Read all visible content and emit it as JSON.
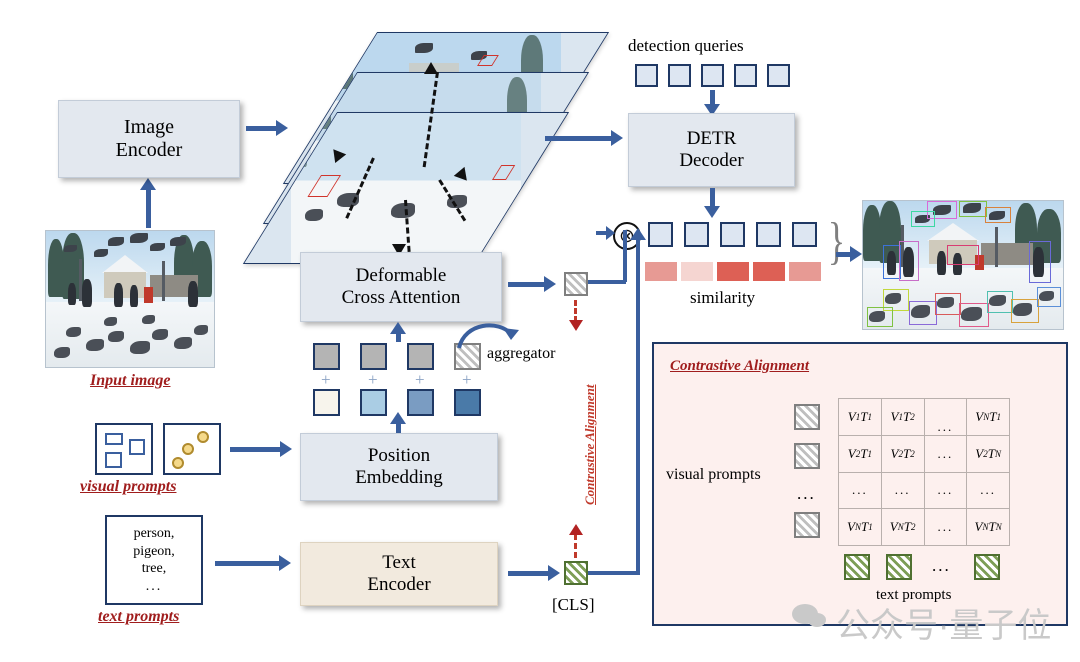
{
  "modules": {
    "image_encoder": "Image\nEncoder",
    "image_encoder_l1": "Image",
    "image_encoder_l2": "Encoder",
    "detr_l1": "DETR",
    "detr_l2": "Decoder",
    "deformable_l1": "Deformable",
    "deformable_l2": "Cross Attention",
    "position_l1": "Position",
    "position_l2": "Embedding",
    "text_l1": "Text",
    "text_l2": "Encoder"
  },
  "labels": {
    "input_image": "Input image",
    "visual_prompts": "visual prompts",
    "text_prompts": "text prompts",
    "detection_queries": "detection queries",
    "similarity": "similarity",
    "aggregator": "aggregator",
    "cls": "[CLS]",
    "contrastive_vertical": "Contrastive Alignment",
    "contrastive_title": "Contrastive Alignment",
    "panel_visual_prompts": "visual prompts",
    "panel_text_prompts": "text prompts",
    "ellipsis": "...",
    "otimes": "⊗",
    "plus": "+"
  },
  "text_prompt_box": {
    "lines": [
      "person,",
      "pigeon,",
      "tree,",
      "..."
    ]
  },
  "detection_queries": {
    "count": 5
  },
  "decoder_outputs": {
    "count": 5
  },
  "similarity_bars": {
    "colors": [
      "#e79a94",
      "#f5d5d1",
      "#dd6055",
      "#dd6055",
      "#e79a94"
    ],
    "values": [
      0.55,
      0.18,
      0.9,
      0.9,
      0.55
    ]
  },
  "aggregator_tokens": {
    "top_color": "#b4b4b4",
    "bottom_colors": [
      "#f7f4ec",
      "#aacde4",
      "#7a9cc2",
      "#4a7aa8"
    ]
  },
  "matrix": {
    "rows": [
      [
        {
          "t": "V",
          "sub": "1",
          "t2": "T",
          "sub2": "1"
        },
        {
          "t": "V",
          "sub": "1",
          "t2": "T",
          "sub2": "2"
        },
        {
          "dots": true
        },
        {
          "t": "V",
          "sub": "N",
          "t2": "T",
          "sub2": "1"
        }
      ],
      [
        {
          "t": "V",
          "sub": "2",
          "t2": "T",
          "sub2": "1"
        },
        {
          "t": "V",
          "sub": "2",
          "t2": "T",
          "sub2": "2"
        },
        {
          "dots": true
        },
        {
          "t": "V",
          "sub": "2",
          "t2": "T",
          "sub2": "N"
        }
      ],
      [
        {
          "dots": true
        },
        {
          "dots": true
        },
        {
          "dots": true
        },
        {
          "dots": true
        }
      ],
      [
        {
          "t": "V",
          "sub": "N",
          "t2": "T",
          "sub2": "1"
        },
        {
          "t": "V",
          "sub": "N",
          "t2": "T",
          "sub2": "2"
        },
        {
          "dots": true
        },
        {
          "t": "V",
          "sub": "N",
          "t2": "T",
          "sub2": "N"
        }
      ]
    ]
  },
  "watermark": {
    "text": "公众号·量子位"
  },
  "colors": {
    "arrow_blue": "#3a5f9e",
    "dark_navy": "#1f3864",
    "accent_red": "#a01d1d",
    "dashed_red": "#c0392b",
    "module_bg": "#e3e8ef",
    "text_module_bg": "#f2eade",
    "panel_bg": "#fdf0ee",
    "hatch_green": "#4f7031",
    "hatch_gray": "#7f7f7f"
  },
  "detection_box_colors": [
    "#c86ec8",
    "#5a8fd8",
    "#7fc242",
    "#e05a8a",
    "#8a6ad8",
    "#d8a23c",
    "#4fc0b0",
    "#d85a5a",
    "#6ad86a",
    "#d86ad8",
    "#3c72d8",
    "#c2d83c",
    "#d8823c",
    "#6a6ad8",
    "#d83c72",
    "#3cd8a2"
  ]
}
